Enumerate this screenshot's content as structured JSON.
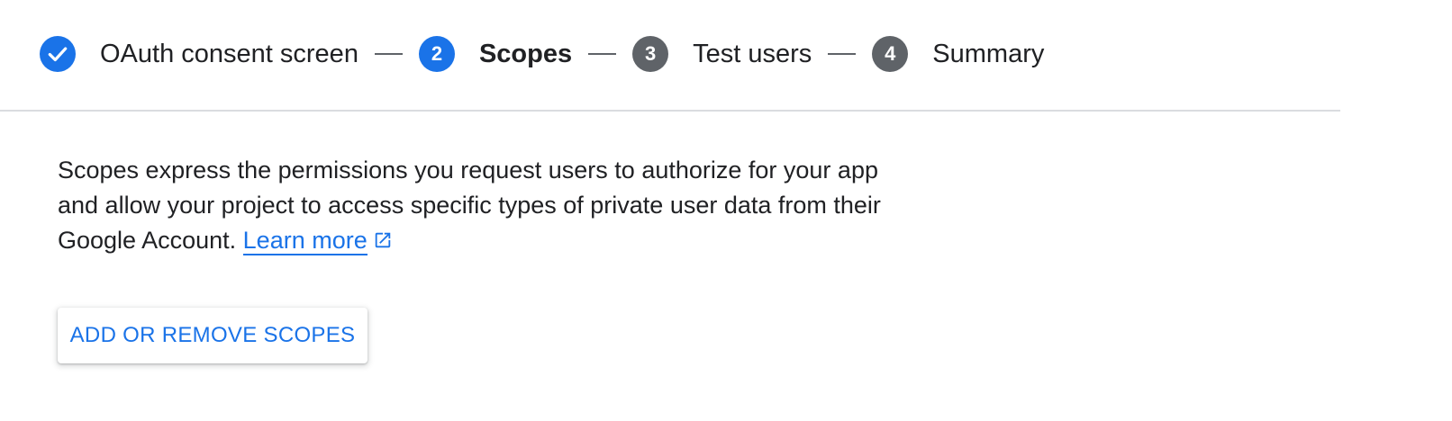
{
  "stepper": {
    "steps": [
      {
        "label": "OAuth consent screen",
        "number": "",
        "state": "complete",
        "icon": "check-icon"
      },
      {
        "label": "Scopes",
        "number": "2",
        "state": "active"
      },
      {
        "label": "Test users",
        "number": "3",
        "state": "pending"
      },
      {
        "label": "Summary",
        "number": "4",
        "state": "pending"
      }
    ]
  },
  "main": {
    "description": "Scopes express the permissions you request users to authorize for your app and allow your project to access specific types of private user data from their Google Account.",
    "learn_more": "Learn more",
    "learn_more_icon": "open-in-new-icon",
    "add_remove_button": "ADD OR REMOVE SCOPES"
  },
  "colors": {
    "accent": "#1a73e8",
    "pending": "#5f6368",
    "text": "#202124",
    "divider": "#dadce0"
  }
}
